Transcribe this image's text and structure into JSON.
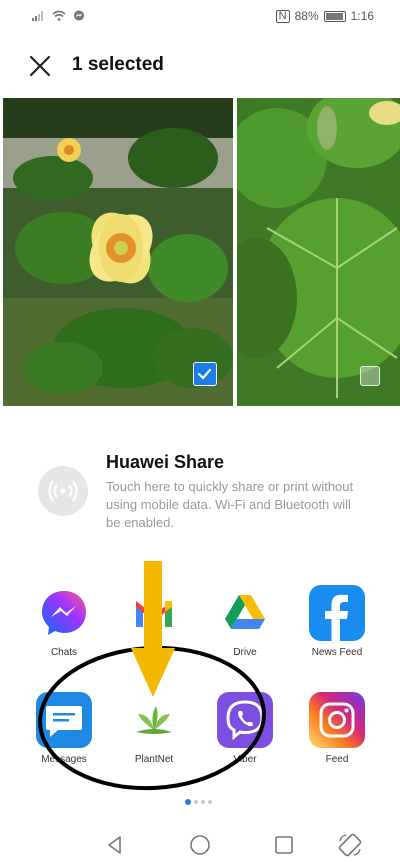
{
  "status_bar": {
    "battery": "88%",
    "time": "1:16",
    "icons": [
      "signal-icon",
      "wifi-icon",
      "messenger-notification-icon",
      "nfc-icon",
      "battery-icon"
    ]
  },
  "header": {
    "title": "1 selected",
    "close_icon": "close-icon"
  },
  "photos": [
    {
      "selected": true
    },
    {
      "selected": false
    }
  ],
  "huawei_share": {
    "title": "Huawei Share",
    "description": "Touch here to quickly share or print without using mobile data. Wi-Fi and Bluetooth will be enabled."
  },
  "apps": [
    {
      "label": "Chats",
      "icon": "messenger-icon"
    },
    {
      "label": "",
      "icon": "gmail-icon"
    },
    {
      "label": "Drive",
      "icon": "google-drive-icon"
    },
    {
      "label": "News Feed",
      "icon": "facebook-icon"
    },
    {
      "label": "Messages",
      "icon": "messages-icon"
    },
    {
      "label": "PlantNet",
      "icon": "plantnet-icon"
    },
    {
      "label": "Viber",
      "icon": "viber-icon"
    },
    {
      "label": "Feed",
      "icon": "instagram-icon"
    }
  ],
  "pager": {
    "pages": 4,
    "current": 1
  },
  "colors": {
    "accent": "#1a7ee8",
    "annotation_arrow": "#f5b800",
    "annotation_circle": "#000000"
  }
}
